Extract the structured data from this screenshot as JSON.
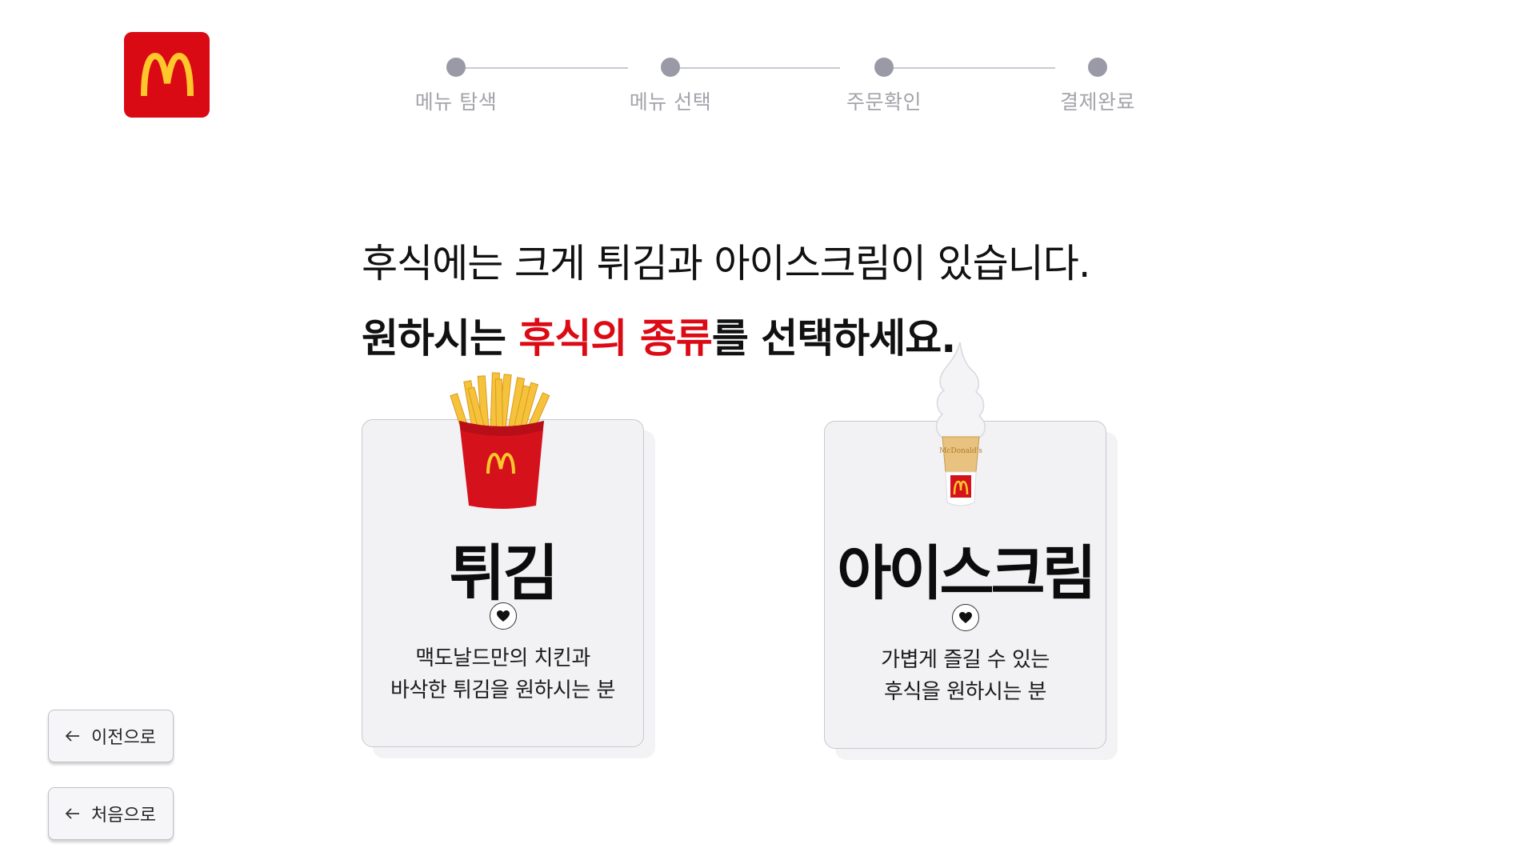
{
  "brand": {
    "logo_icon": "golden-arches-icon",
    "color": "#da0a14",
    "arches_color": "#ffc72c"
  },
  "stepper": {
    "steps": [
      {
        "label": "메뉴 탐색"
      },
      {
        "label": "메뉴 선택"
      },
      {
        "label": "주문확인"
      },
      {
        "label": "결제완료"
      }
    ],
    "dot_color": "#9a9aa6",
    "line_color": "#c9cad1"
  },
  "heading": {
    "line1": "후식에는 크게 튀김과 아이스크림이 있습니다.",
    "line2_prefix": "원하시는 ",
    "line2_accent": "후식의 종류",
    "line2_suffix": "를 선택하세요.",
    "accent_color": "#dc0a14"
  },
  "options": [
    {
      "title": "튀김",
      "icon": "heart-icon",
      "desc_line1": "맥도날드만의 치킨과",
      "desc_line2": "바삭한 튀김을 원하시는 분",
      "image": "french-fries-image"
    },
    {
      "title": "아이스크림",
      "icon": "heart-icon",
      "desc_line1": "가볍게 즐길 수 있는",
      "desc_line2": "후식을 원하시는 분",
      "image": "soft-serve-cone-image",
      "cone_text": "McDonald's"
    }
  ],
  "nav": {
    "prev_label": "이전으로",
    "home_label": "처음으로",
    "arrow_icon": "arrow-left-icon"
  }
}
